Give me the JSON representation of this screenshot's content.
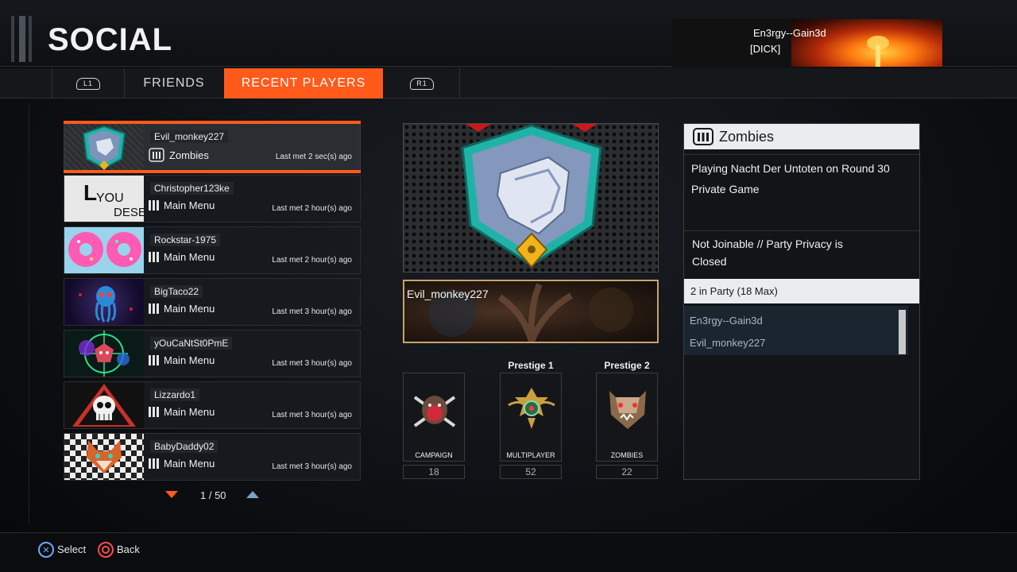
{
  "header": {
    "title": "SOCIAL",
    "profile": {
      "name": "En3rgy--Gain3d",
      "clan_tag": "[DICK]"
    }
  },
  "tabs": {
    "left_bumper": "L1",
    "right_bumper": "R1",
    "items": [
      {
        "label": "FRIENDS",
        "active": false
      },
      {
        "label": "RECENT PLAYERS",
        "active": true
      }
    ]
  },
  "players": [
    {
      "name": "Evil_monkey227",
      "status": "Zombies",
      "last_met": "Last met 2 sec(s) ago",
      "selected": true
    },
    {
      "name": "Christopher123ke",
      "status": "Main Menu",
      "last_met": "Last met 2 hour(s) ago"
    },
    {
      "name": "Rockstar-1975",
      "status": "Main Menu",
      "last_met": "Last met 2 hour(s) ago"
    },
    {
      "name": "BigTaco22",
      "status": "Main Menu",
      "last_met": "Last met 3 hour(s) ago"
    },
    {
      "name": "yOuCaNtSt0PmE",
      "status": "Main Menu",
      "last_met": "Last met 3 hour(s) ago"
    },
    {
      "name": "Lizzardo1",
      "status": "Main Menu",
      "last_met": "Last met 3 hour(s) ago"
    },
    {
      "name": "BabyDaddy02",
      "status": "Main Menu",
      "last_met": "Last met 3 hour(s) ago"
    }
  ],
  "avatar_text": {
    "line1": "L",
    "line2": "YOU",
    "line3": "DESE"
  },
  "pagination": {
    "label": "1 / 50"
  },
  "detail": {
    "calling_name": "Evil_monkey227",
    "prestige": [
      "Prestige 1",
      "Prestige 2"
    ],
    "modes": [
      {
        "label": "CAMPAIGN",
        "value": "18"
      },
      {
        "label": "MULTIPLAYER",
        "value": "52"
      },
      {
        "label": "ZOMBIES",
        "value": "22"
      }
    ]
  },
  "status_panel": {
    "mode": "Zombies",
    "line1": "Playing Nacht Der Untoten on Round 30",
    "line2": "Private Game",
    "join1": "Not Joinable // Party Privacy is",
    "join2": "Closed",
    "party_header": "2 in Party (18 Max)",
    "party_members": [
      "En3rgy--Gain3d",
      "Evil_monkey227"
    ]
  },
  "footer": {
    "select": "Select",
    "back": "Back"
  },
  "colors": {
    "accent": "#ff5a1a",
    "panel_header": "#e9edf0",
    "cross": "#6aa9ff",
    "circle": "#ff4a4a"
  }
}
